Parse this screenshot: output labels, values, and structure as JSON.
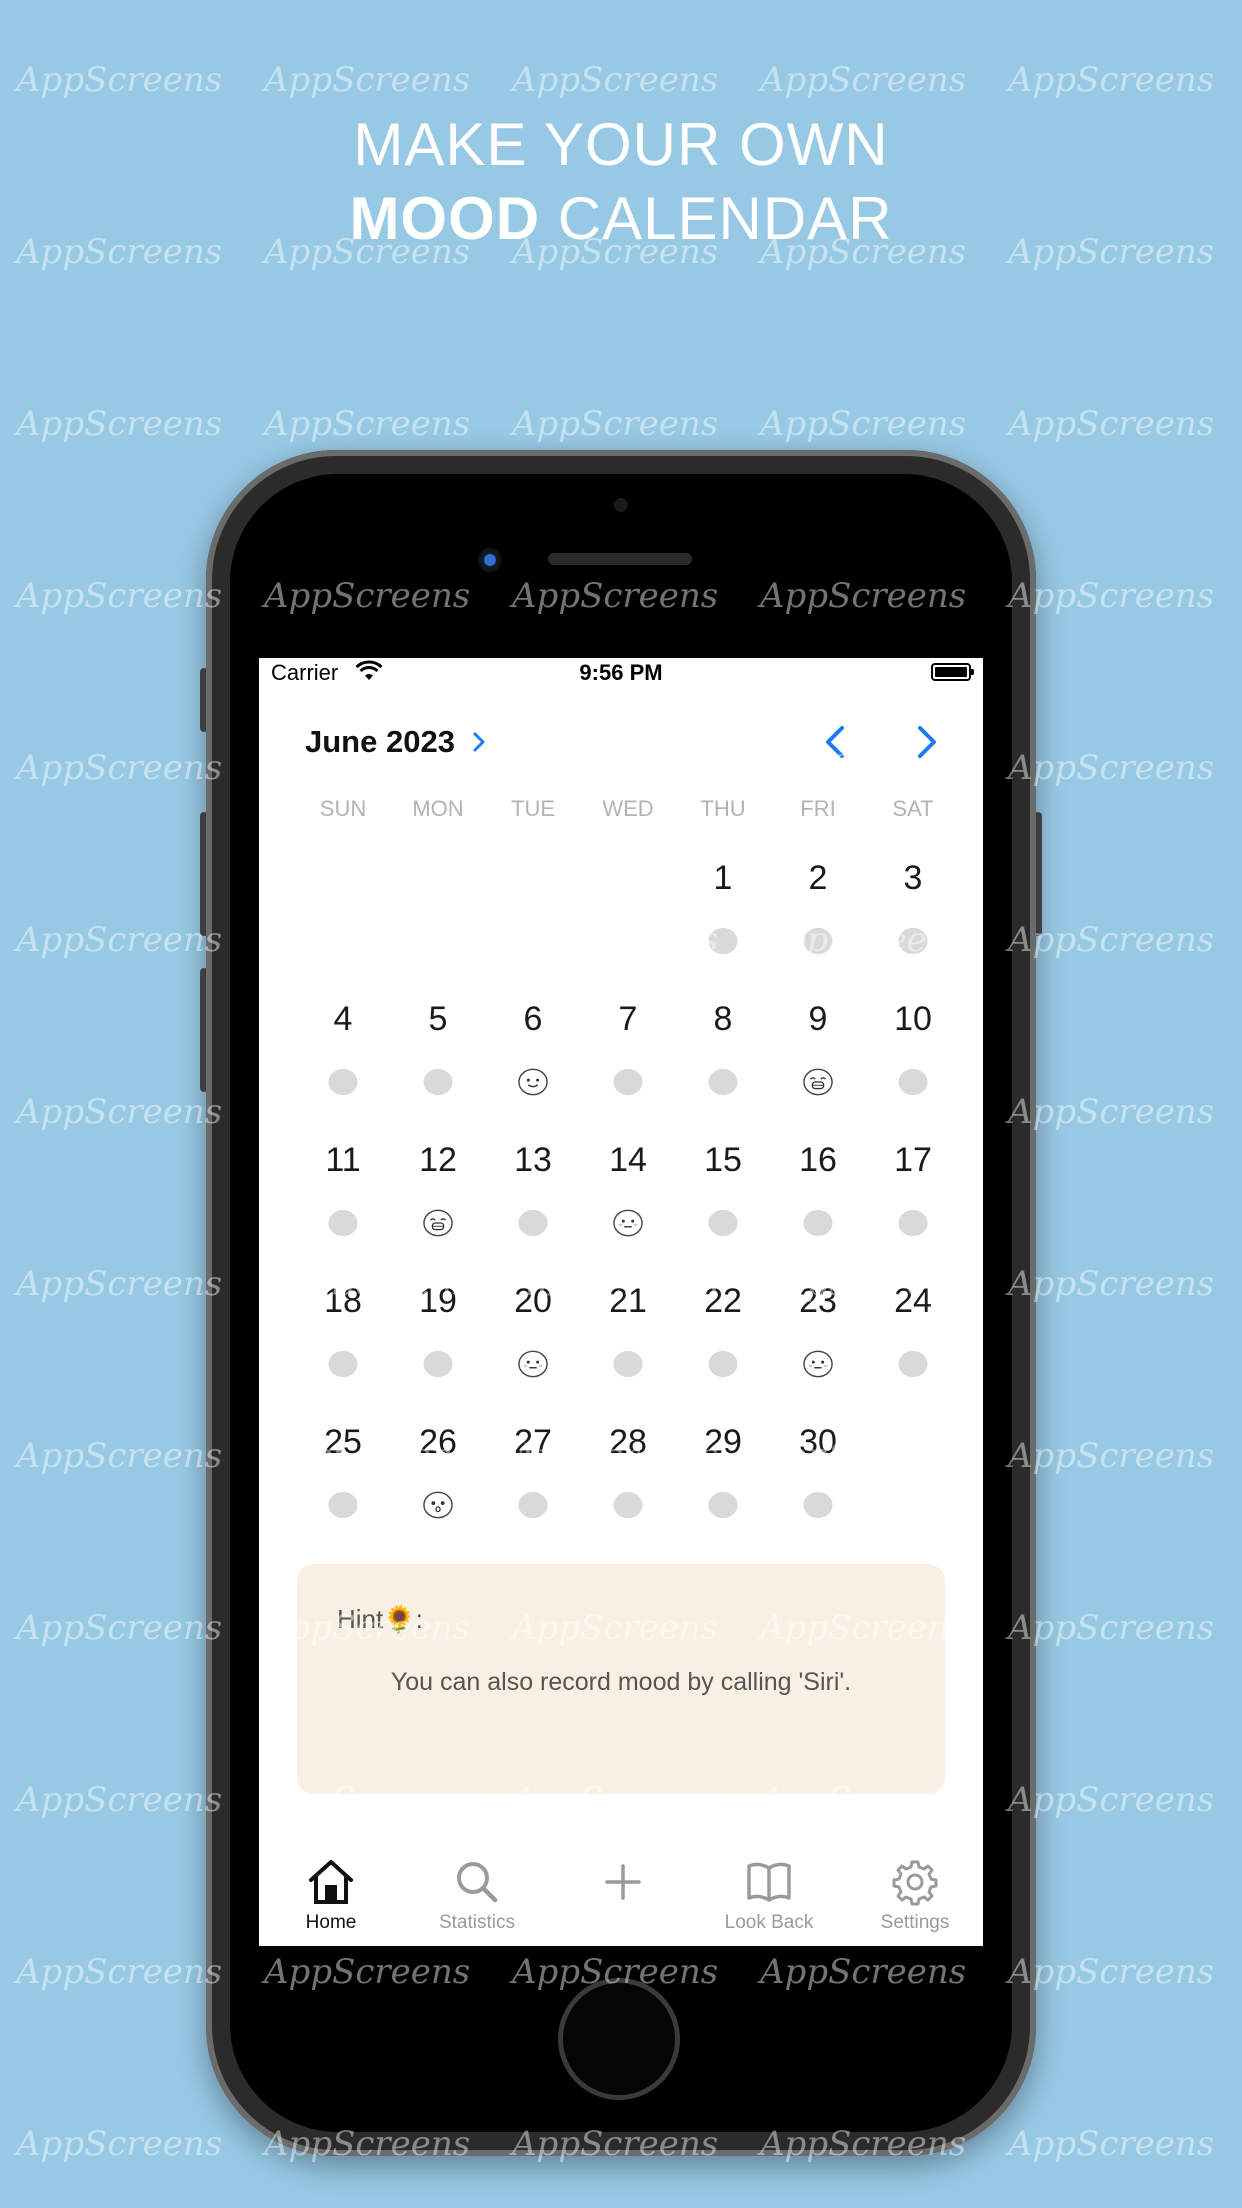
{
  "watermark": "AppScreens",
  "headline": {
    "line1": "MAKE YOUR OWN",
    "line2_bold": "MOOD",
    "line2_rest": " CALENDAR"
  },
  "status_bar": {
    "carrier": "Carrier",
    "time": "9:56 PM"
  },
  "calendar": {
    "month_label": "June 2023",
    "weekdays": [
      "SUN",
      "MON",
      "TUE",
      "WED",
      "THU",
      "FRI",
      "SAT"
    ],
    "first_weekday_index": 4,
    "days_in_month": 30,
    "moods": {
      "6": "smile",
      "9": "grin",
      "12": "grin",
      "14": "content",
      "20": "content",
      "23": "content",
      "26": "surprised"
    },
    "empty_mood_color": "#d9d9d9"
  },
  "hint": {
    "title": "Hint",
    "title_emoji": "🌻",
    "title_suffix": ":",
    "text": "You can also record mood by calling 'Siri'."
  },
  "tabs": [
    {
      "label": "Home",
      "icon": "home-icon",
      "active": true
    },
    {
      "label": "Statistics",
      "icon": "search-icon",
      "active": false
    },
    {
      "label": "",
      "icon": "plus-icon",
      "active": false
    },
    {
      "label": "Look Back",
      "icon": "book-icon",
      "active": false
    },
    {
      "label": "Settings",
      "icon": "gear-icon",
      "active": false
    }
  ],
  "colors": {
    "background": "#97c9e5",
    "accent": "#1a7cf0",
    "hint_bg": "#f9f0e3"
  }
}
